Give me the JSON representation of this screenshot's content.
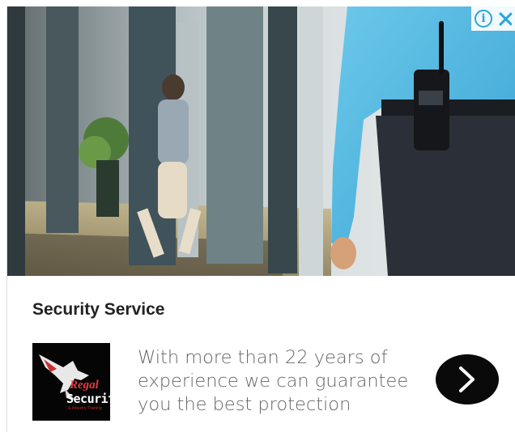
{
  "ad": {
    "headline": "Security Service",
    "description": "With more than 22 years of experience we can guarantee you the best protection",
    "logo": {
      "brand_line_1": "Regal",
      "brand_line_2": "Security",
      "brand_line_3": "& Industry Training"
    },
    "icons": {
      "info": "info-icon",
      "close": "close-icon",
      "cta": "chevron-right-icon"
    },
    "colors": {
      "adchoices_blue": "#26a7e0",
      "cta_background": "#0a0a0a",
      "headline": "#222222",
      "description": "#666666"
    }
  }
}
